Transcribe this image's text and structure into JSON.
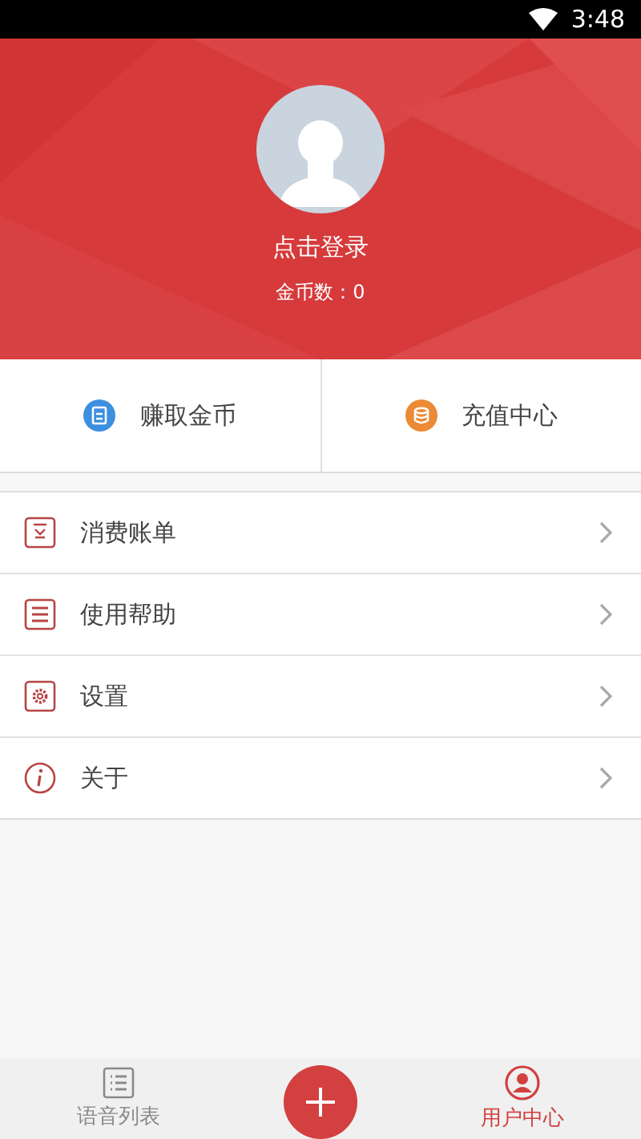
{
  "status_bar": {
    "time": "3:48"
  },
  "profile": {
    "login_label": "点击登录",
    "coins": "金币数：0"
  },
  "quick_actions": [
    {
      "kind": "earn",
      "label": "赚取金币",
      "color": "#3d8fe0"
    },
    {
      "kind": "recharge",
      "label": "充值中心",
      "color": "#ec8a36"
    }
  ],
  "menu": [
    {
      "kind": "bill",
      "label": "消费账单"
    },
    {
      "kind": "help",
      "label": "使用帮助"
    },
    {
      "kind": "settings",
      "label": "设置"
    },
    {
      "kind": "about",
      "label": "关于"
    }
  ],
  "tab_bar": [
    {
      "kind": "list",
      "label": "语音列表",
      "selected": false
    },
    {
      "kind": "add"
    },
    {
      "kind": "user",
      "label": "用户中心",
      "selected": true
    }
  ]
}
